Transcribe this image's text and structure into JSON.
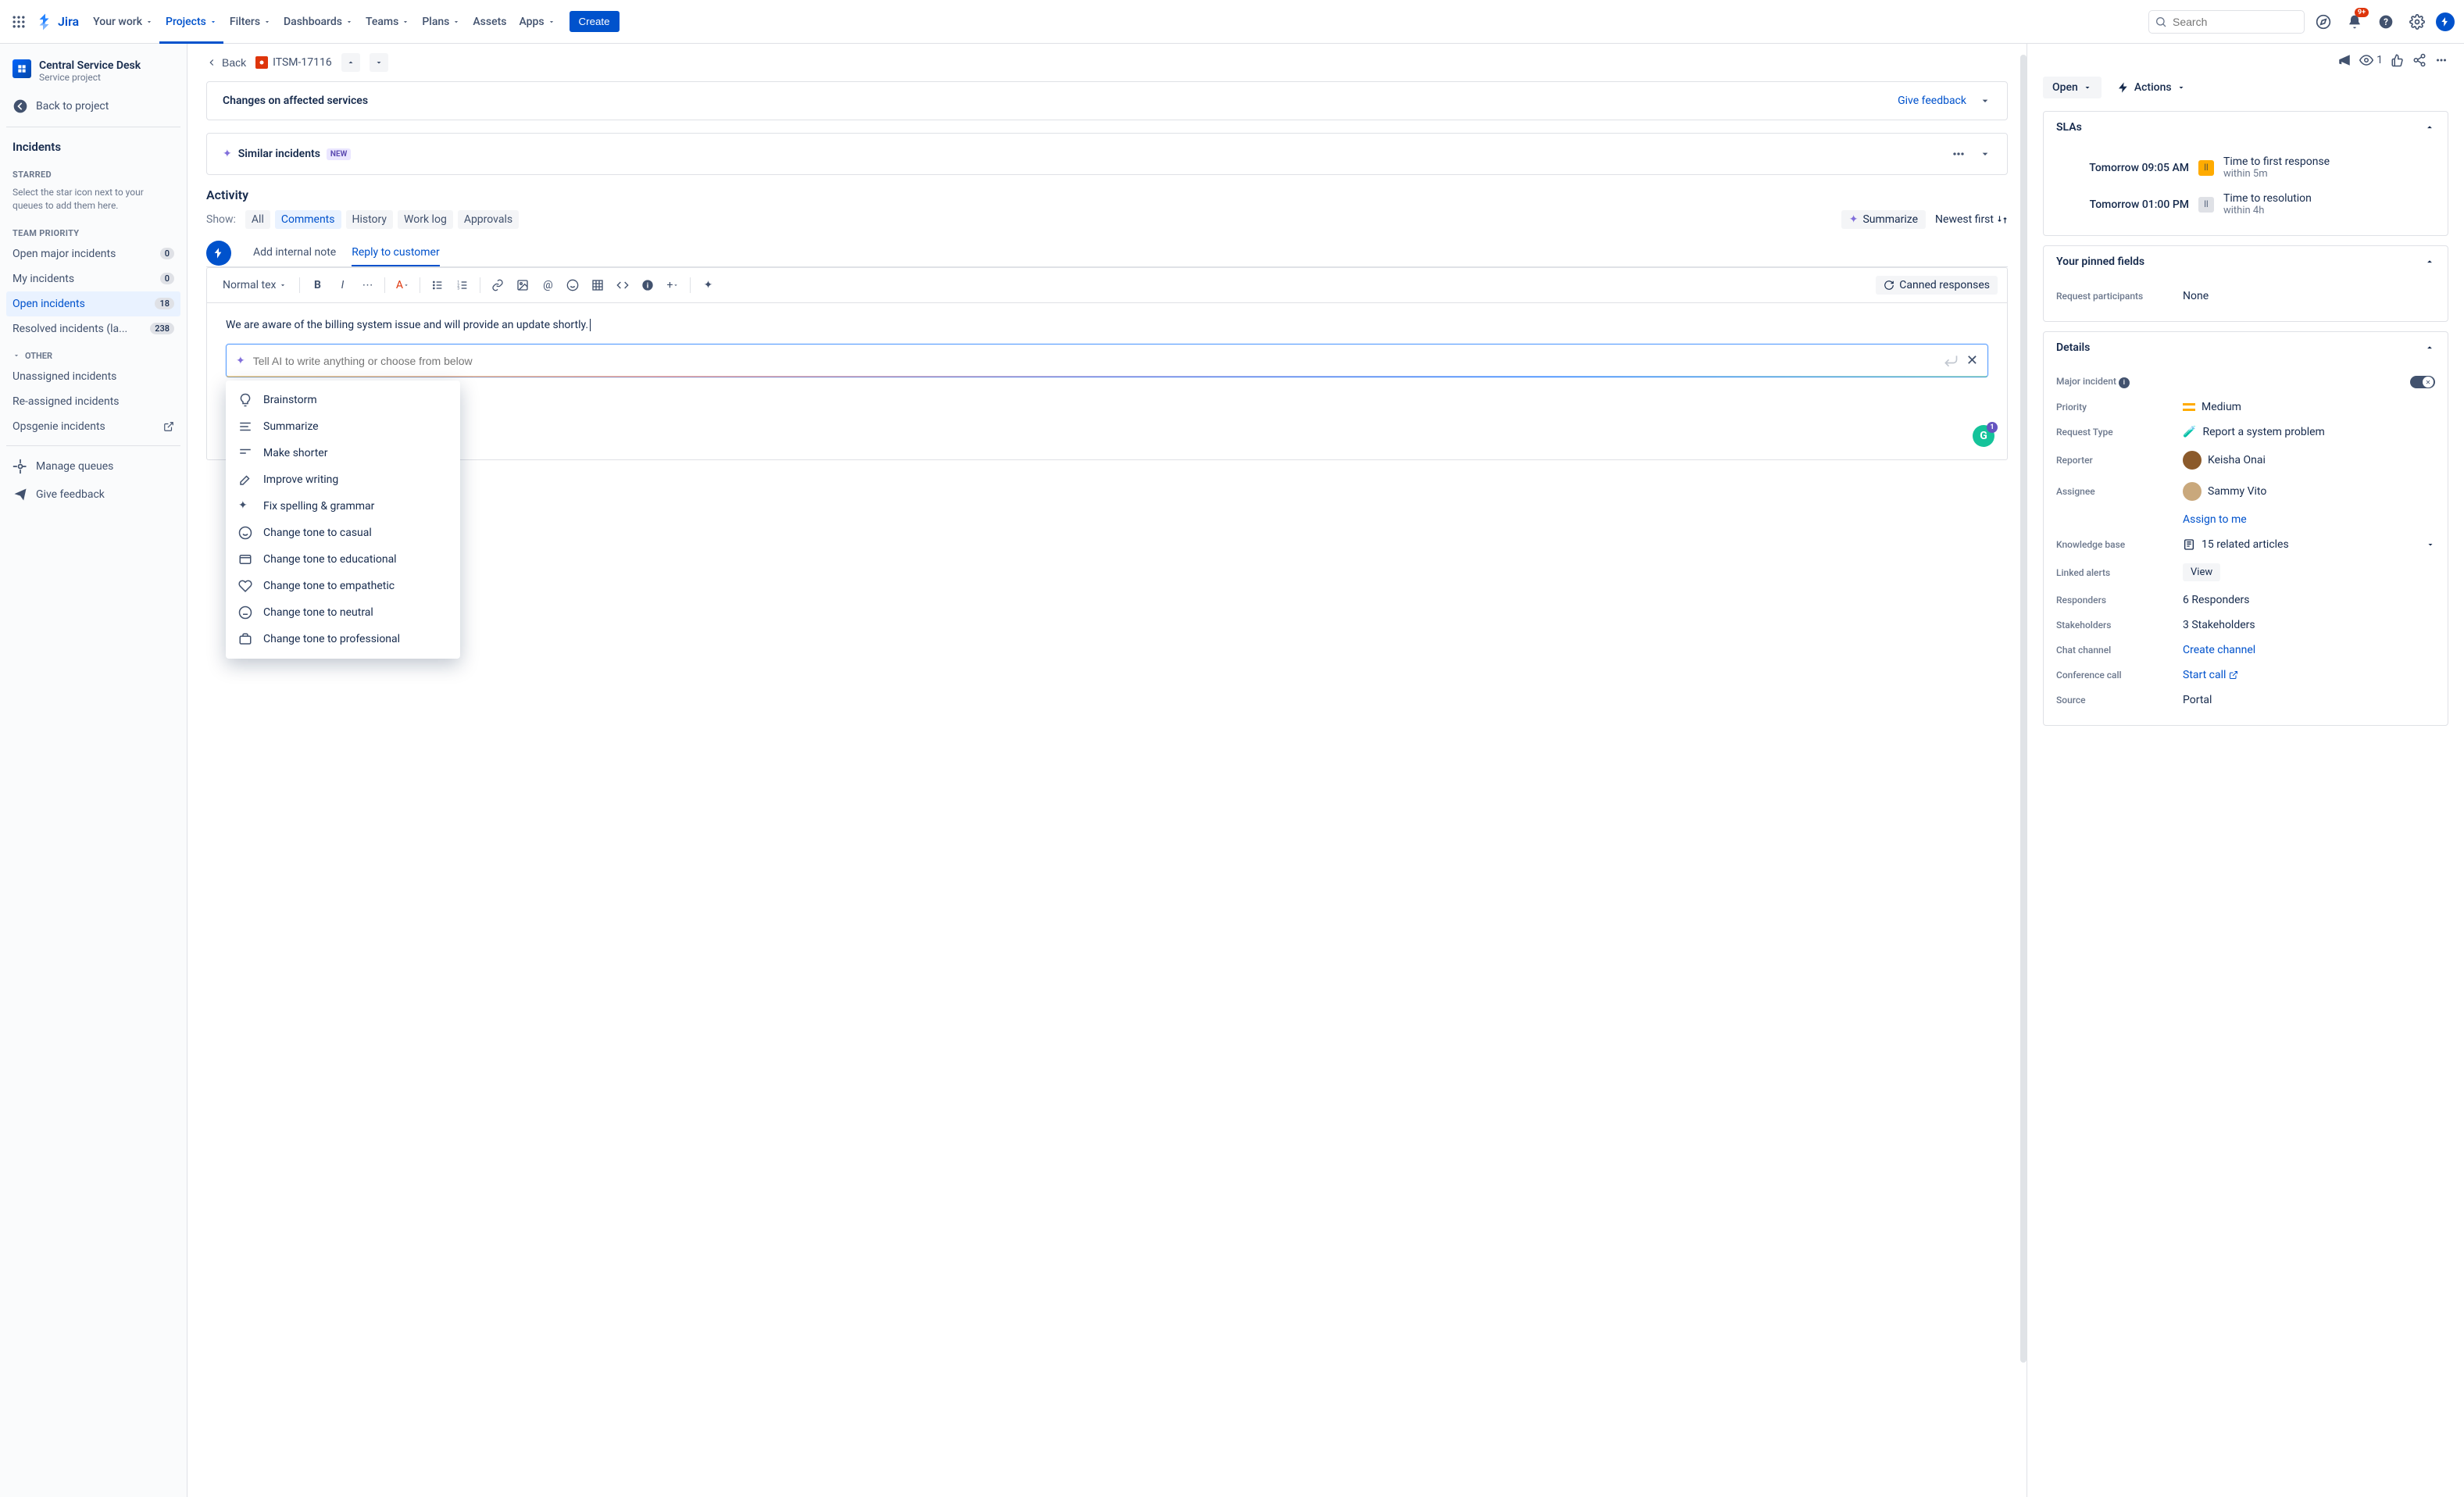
{
  "topnav": {
    "logo": "Jira",
    "items": [
      "Your work",
      "Projects",
      "Filters",
      "Dashboards",
      "Teams",
      "Plans",
      "Assets",
      "Apps"
    ],
    "active_index": 1,
    "create": "Create",
    "search_placeholder": "Search",
    "notif_badge": "9+"
  },
  "sidebar": {
    "project_name": "Central Service Desk",
    "project_type": "Service project",
    "back_link": "Back to project",
    "section_title": "Incidents",
    "starred_heading": "STARRED",
    "starred_help": "Select the star icon next to your queues to add them here.",
    "priority_heading": "TEAM PRIORITY",
    "queues": [
      {
        "label": "Open major incidents",
        "count": "0"
      },
      {
        "label": "My incidents",
        "count": "0"
      },
      {
        "label": "Open incidents",
        "count": "18",
        "active": true
      },
      {
        "label": "Resolved incidents (la...",
        "count": "238"
      }
    ],
    "other_heading": "OTHER",
    "other": [
      "Unassigned incidents",
      "Re-assigned incidents",
      "Opsgenie incidents"
    ],
    "manage": "Manage queues",
    "feedback": "Give feedback"
  },
  "crumb": {
    "back": "Back",
    "key": "ITSM-17116"
  },
  "panels": {
    "affected_title": "Changes on affected services",
    "feedback_link": "Give feedback",
    "similar_title": "Similar incidents",
    "new_label": "NEW"
  },
  "activity": {
    "title": "Activity",
    "show": "Show:",
    "tabs": [
      "All",
      "Comments",
      "History",
      "Work log",
      "Approvals"
    ],
    "active_tab": 1,
    "summarize": "Summarize",
    "sort": "Newest first"
  },
  "comment_tabs": {
    "note": "Add internal note",
    "reply": "Reply to customer"
  },
  "toolbar": {
    "style": "Normal tex",
    "canned": "Canned responses"
  },
  "editor": {
    "text": "We are aware of the billing system issue and will provide an update shortly.",
    "ai_placeholder": "Tell AI to write anything or choose from below"
  },
  "ai_menu": [
    "Brainstorm",
    "Summarize",
    "Make shorter",
    "Improve writing",
    "Fix spelling & grammar",
    "Change tone to casual",
    "Change tone to educational",
    "Change tone to empathetic",
    "Change tone to neutral",
    "Change tone to professional"
  ],
  "right": {
    "watch_count": "1",
    "status": "Open",
    "actions": "Actions",
    "slas_title": "SLAs",
    "slas": [
      {
        "time": "Tomorrow 09:05 AM",
        "label": "Time to first response",
        "sub": "within 5m",
        "pause": "yellow"
      },
      {
        "time": "Tomorrow 01:00 PM",
        "label": "Time to resolution",
        "sub": "within 4h",
        "pause": "gray"
      }
    ],
    "pinned_title": "Your pinned fields",
    "pinned_label": "Request participants",
    "pinned_value": "None",
    "details_title": "Details",
    "fields": {
      "major": {
        "label": "Major incident"
      },
      "priority": {
        "label": "Priority",
        "value": "Medium"
      },
      "request_type": {
        "label": "Request Type",
        "value": "Report a system problem"
      },
      "reporter": {
        "label": "Reporter",
        "value": "Keisha Onai"
      },
      "assignee": {
        "label": "Assignee",
        "value": "Sammy Vito",
        "assign_me": "Assign to me"
      },
      "kb": {
        "label": "Knowledge base",
        "value": "15 related articles"
      },
      "alerts": {
        "label": "Linked alerts",
        "value": "View"
      },
      "responders": {
        "label": "Responders",
        "value": "6 Responders"
      },
      "stakeholders": {
        "label": "Stakeholders",
        "value": "3 Stakeholders"
      },
      "chat": {
        "label": "Chat channel",
        "value": "Create channel"
      },
      "conf": {
        "label": "Conference call",
        "value": "Start call"
      },
      "source": {
        "label": "Source",
        "value": "Portal"
      }
    }
  }
}
